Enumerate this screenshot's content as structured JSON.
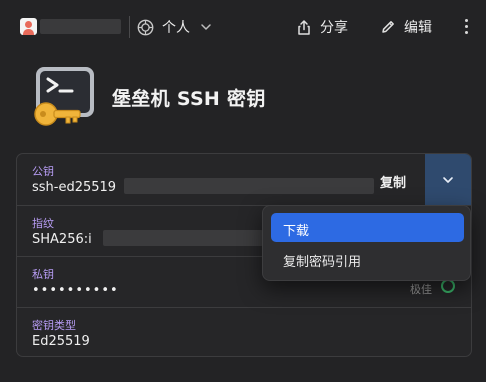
{
  "topbar": {
    "vault_name": "个人",
    "share_label": "分享",
    "edit_label": "编辑"
  },
  "item": {
    "title": "堡垒机 SSH 密钥"
  },
  "fields": {
    "public_key": {
      "label": "公钥",
      "value": "ssh-ed25519",
      "copy_label": "复制"
    },
    "fingerprint": {
      "label": "指纹",
      "value": "SHA256:i"
    },
    "private_key": {
      "label": "私钥",
      "value": "••••••••••",
      "strength_label": "极佳"
    },
    "key_type": {
      "label": "密钥类型",
      "value": "Ed25519"
    }
  },
  "menu": {
    "items": [
      {
        "label": "下载",
        "highlighted": true
      },
      {
        "label": "复制密码引用",
        "highlighted": false
      }
    ]
  },
  "colors": {
    "background": "#232325",
    "field_label": "#b79cf3",
    "split_button": "#2f4a6e",
    "menu_highlight": "#2d6ae3",
    "strength_ok": "#3bb76b"
  }
}
